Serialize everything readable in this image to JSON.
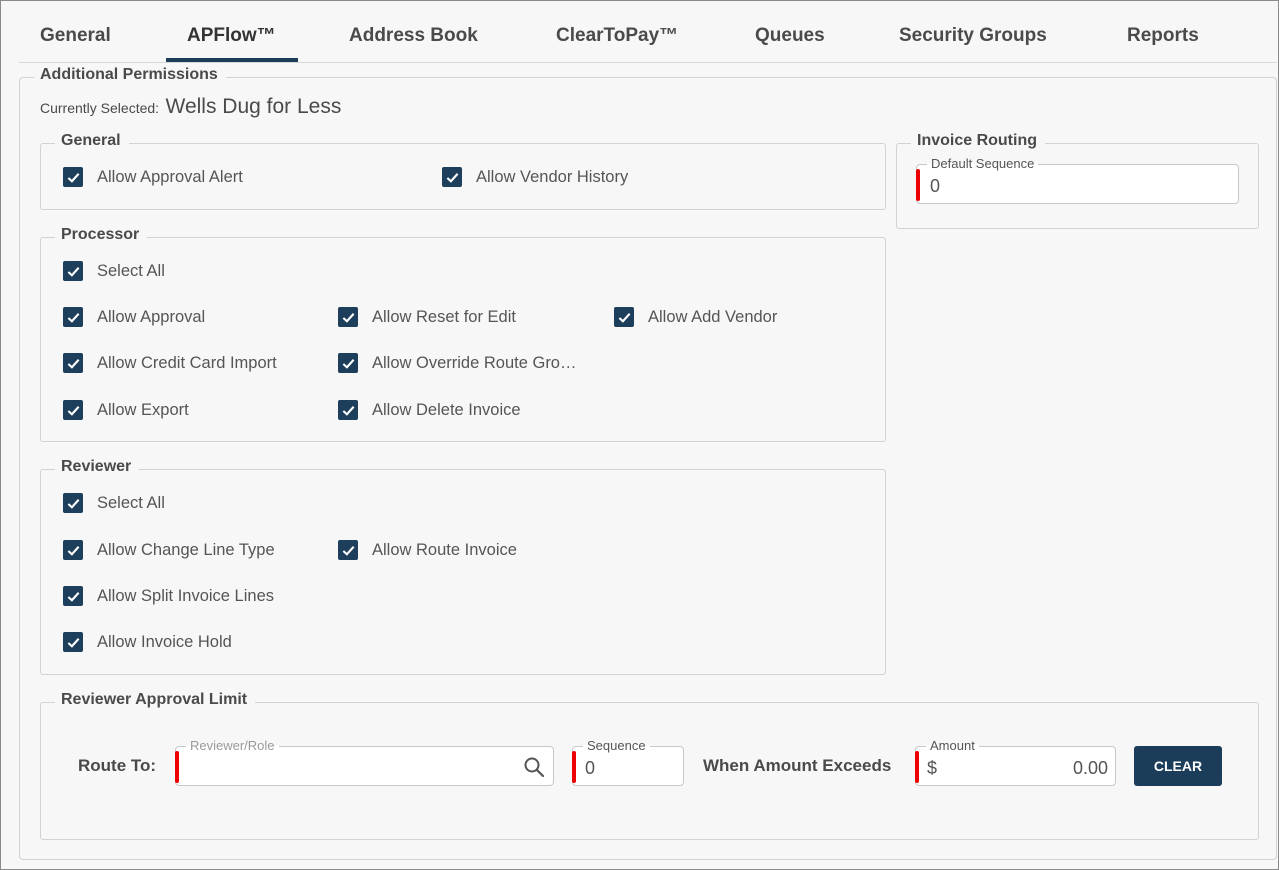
{
  "tabs": [
    {
      "label": "General"
    },
    {
      "label": "APFlow™"
    },
    {
      "label": "Address Book"
    },
    {
      "label": "ClearToPay™"
    },
    {
      "label": "Queues"
    },
    {
      "label": "Security Groups"
    },
    {
      "label": "Reports"
    }
  ],
  "active_tab": "APFlow™",
  "additional_permissions": {
    "legend": "Additional Permissions",
    "currently_selected_label": "Currently Selected:",
    "currently_selected_value": "Wells Dug for Less"
  },
  "general": {
    "legend": "General",
    "items": [
      {
        "label": "Allow Approval Alert",
        "checked": true
      },
      {
        "label": "Allow Vendor History",
        "checked": true
      }
    ]
  },
  "processor": {
    "legend": "Processor",
    "select_all": "Select All",
    "items": [
      {
        "label": "Allow Approval",
        "checked": true
      },
      {
        "label": "Allow Reset for Edit",
        "checked": true
      },
      {
        "label": "Allow Add Vendor",
        "checked": true
      },
      {
        "label": "Allow Credit Card Import",
        "checked": true
      },
      {
        "label": "Allow Override Route Gro…",
        "checked": true
      },
      {
        "label": "Allow Export",
        "checked": true
      },
      {
        "label": "Allow Delete Invoice",
        "checked": true
      }
    ]
  },
  "reviewer": {
    "legend": "Reviewer",
    "select_all": "Select All",
    "items": [
      {
        "label": "Allow Change Line Type",
        "checked": true
      },
      {
        "label": "Allow Route Invoice",
        "checked": true
      },
      {
        "label": "Allow Split Invoice Lines",
        "checked": true
      },
      {
        "label": "Allow Invoice Hold",
        "checked": true
      }
    ]
  },
  "invoice_routing": {
    "legend": "Invoice Routing",
    "default_sequence_label": "Default Sequence",
    "default_sequence_value": "0"
  },
  "reviewer_approval_limit": {
    "legend": "Reviewer Approval Limit",
    "route_to_label": "Route To:",
    "reviewer_role_placeholder": "Reviewer/Role",
    "sequence_label": "Sequence",
    "sequence_value": "0",
    "when_amount_exceeds_label": "When Amount Exceeds",
    "amount_label": "Amount",
    "currency_symbol": "$",
    "amount_value": "0.00",
    "clear_button": "CLEAR"
  },
  "colors": {
    "accent": "#1b3d5a",
    "required": "#e00000",
    "background": "#f7f7f8"
  }
}
